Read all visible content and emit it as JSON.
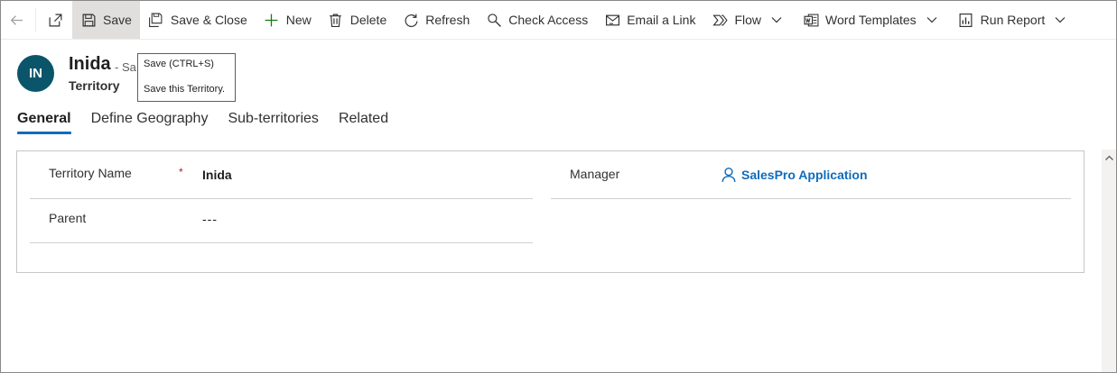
{
  "toolbar": {
    "back_icon": "back-arrow-icon",
    "popout_icon": "popout-icon",
    "items": [
      {
        "label": "Save",
        "icon": "save-icon"
      },
      {
        "label": "Save & Close",
        "icon": "save-close-icon"
      },
      {
        "label": "New",
        "icon": "plus-icon"
      },
      {
        "label": "Delete",
        "icon": "trash-icon"
      },
      {
        "label": "Refresh",
        "icon": "refresh-icon"
      },
      {
        "label": "Check Access",
        "icon": "key-search-icon"
      },
      {
        "label": "Email a Link",
        "icon": "email-link-icon"
      },
      {
        "label": "Flow",
        "icon": "flow-icon"
      },
      {
        "label": "Word Templates",
        "icon": "word-icon"
      },
      {
        "label": "Run Report",
        "icon": "report-icon"
      }
    ]
  },
  "tooltip": {
    "shortcut": "Save (CTRL+S)",
    "description": "Save this Territory."
  },
  "header": {
    "avatar_initials": "IN",
    "title": "Inida",
    "status": "- Sa",
    "entity": "Territory"
  },
  "tabs": [
    {
      "label": "General",
      "active": true
    },
    {
      "label": "Define Geography",
      "active": false
    },
    {
      "label": "Sub-territories",
      "active": false
    },
    {
      "label": "Related",
      "active": false
    }
  ],
  "form": {
    "territory_name": {
      "label": "Territory Name",
      "required_mark": "*",
      "value": "Inida"
    },
    "parent": {
      "label": "Parent",
      "value": "---"
    },
    "manager": {
      "label": "Manager",
      "value": "SalesPro Application",
      "icon": "person-icon"
    }
  },
  "colors": {
    "accent": "#0f6cbd",
    "avatar": "#0b556a",
    "required": "#a4262c",
    "active_command_bg": "#e1dfdd"
  }
}
